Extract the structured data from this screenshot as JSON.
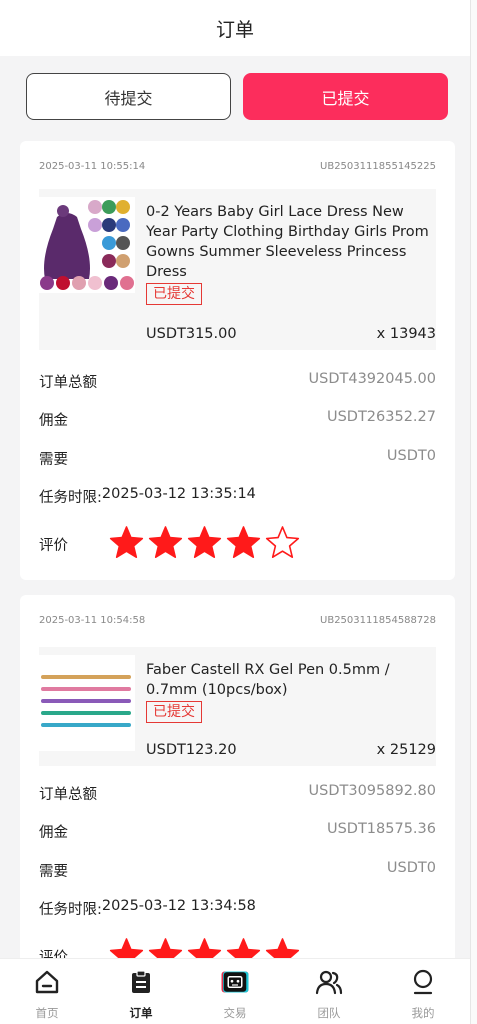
{
  "header": {
    "title": "订单"
  },
  "tabs": [
    {
      "label": "待提交",
      "active": false
    },
    {
      "label": "已提交",
      "active": true
    }
  ],
  "labels": {
    "total": "订单总额",
    "commission": "佣金",
    "required": "需要",
    "deadline_prefix": "任务时限:",
    "rating": "评价"
  },
  "orders": [
    {
      "time": "2025-03-11 10:55:14",
      "order_id": "UB2503111855145225",
      "product_title": "0-2 Years Baby Girl Lace Dress New Year Party Clothing Birthday Girls Prom Gowns Summer Sleeveless Princess Dress",
      "status": "已提交",
      "price": "USDT315.00",
      "quantity": "x 13943",
      "total": "USDT4392045.00",
      "commission": "USDT26352.27",
      "required": "USDT0",
      "deadline": "2025-03-12 13:35:14",
      "rating": 4,
      "rating_max": 5
    },
    {
      "time": "2025-03-11 10:54:58",
      "order_id": "UB2503111854588728",
      "product_title": "Faber Castell RX Gel Pen 0.5mm / 0.7mm (10pcs/box)",
      "status": "已提交",
      "price": "USDT123.20",
      "quantity": "x 25129",
      "total": "USDT3095892.80",
      "commission": "USDT18575.36",
      "required": "USDT0",
      "deadline": "2025-03-12 13:34:58",
      "rating": 5,
      "rating_max": 5
    }
  ],
  "nav": [
    {
      "label": "首页",
      "icon": "home-icon",
      "current": false
    },
    {
      "label": "订单",
      "icon": "clipboard-icon",
      "current": true
    },
    {
      "label": "交易",
      "icon": "robot-icon",
      "current": false
    },
    {
      "label": "团队",
      "icon": "team-icon",
      "current": false
    },
    {
      "label": "我的",
      "icon": "user-icon",
      "current": false
    }
  ],
  "colors": {
    "accent": "#fc2d5c",
    "star": "#ff1a1a",
    "tag": "#e53935"
  }
}
